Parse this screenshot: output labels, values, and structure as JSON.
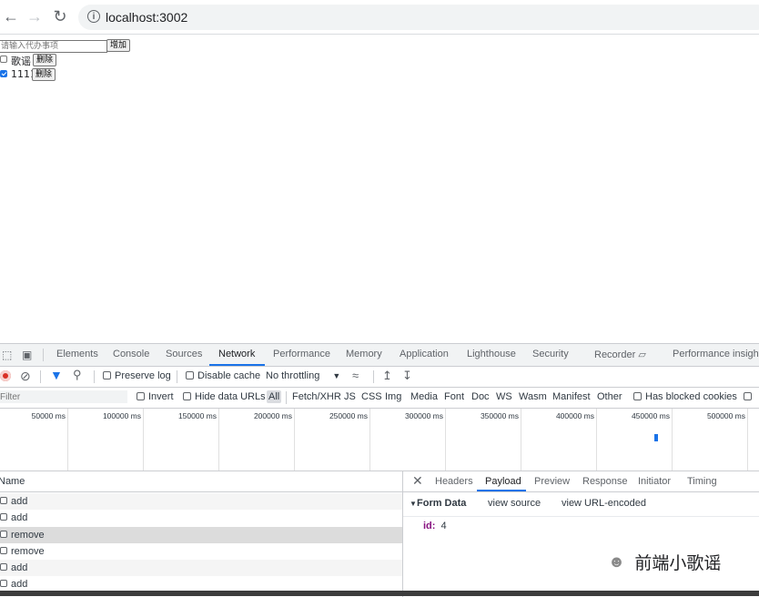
{
  "browser": {
    "url": "localhost:3002",
    "back_icon": "arrow-left",
    "forward_icon": "arrow-right",
    "reload_icon": "reload",
    "info_icon": "info"
  },
  "app": {
    "input_placeholder": "请输入代办事项",
    "add_label": "增加",
    "todos": [
      {
        "text": "歌谣",
        "checked": false,
        "delete_label": "删除"
      },
      {
        "text": "1111",
        "checked": true,
        "delete_label": "删除"
      }
    ]
  },
  "devtools": {
    "tabs": [
      "Elements",
      "Console",
      "Sources",
      "Network",
      "Performance",
      "Memory",
      "Application",
      "Lighthouse",
      "Security",
      "Recorder",
      "Performance insights"
    ],
    "active_tab": "Network",
    "toolbar": {
      "preserve_log": "Preserve log",
      "disable_cache": "Disable cache",
      "throttling": "No throttling"
    },
    "filter": {
      "placeholder": "Filter",
      "invert": "Invert",
      "hide_data_urls": "Hide data URLs",
      "types": [
        "All",
        "Fetch/XHR",
        "JS",
        "CSS",
        "Img",
        "Media",
        "Font",
        "Doc",
        "WS",
        "Wasm",
        "Manifest",
        "Other"
      ],
      "has_blocked_cookies": "Has blocked cookies"
    },
    "timeline_ticks": [
      "50000 ms",
      "100000 ms",
      "150000 ms",
      "200000 ms",
      "250000 ms",
      "300000 ms",
      "350000 ms",
      "400000 ms",
      "450000 ms",
      "500000 ms"
    ],
    "requests_header": "Name",
    "requests": [
      {
        "name": "add",
        "selected": false
      },
      {
        "name": "add",
        "selected": false
      },
      {
        "name": "remove",
        "selected": true
      },
      {
        "name": "remove",
        "selected": false
      },
      {
        "name": "add",
        "selected": false
      },
      {
        "name": "add",
        "selected": false
      }
    ],
    "detail_tabs": [
      "Headers",
      "Payload",
      "Preview",
      "Response",
      "Initiator",
      "Timing"
    ],
    "active_detail_tab": "Payload",
    "payload": {
      "section": "Form Data",
      "view_source": "view source",
      "view_url_encoded": "view URL-encoded",
      "key": "id:",
      "value": "4"
    }
  },
  "watermark": {
    "text": "前端小歌谣",
    "icon": "wechat-icon"
  },
  "colors": {
    "accent": "#1a73e8",
    "record_red": "#d93025",
    "selected_row": "#dcdcdc"
  }
}
